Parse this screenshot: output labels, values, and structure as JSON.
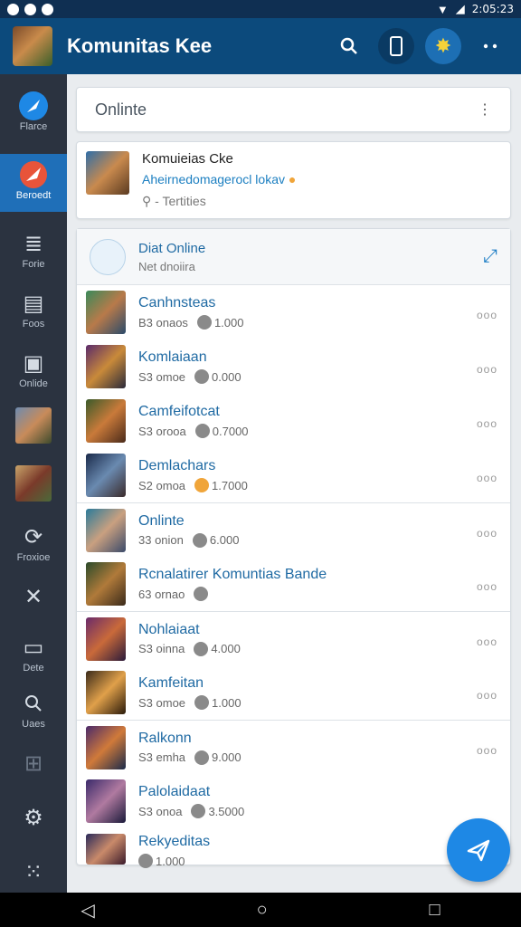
{
  "status": {
    "time": "2:05:23"
  },
  "appbar": {
    "title": "Komunitas Kee"
  },
  "sidebar": [
    {
      "label": "Flarce",
      "icon": "feather-icon",
      "active": false
    },
    {
      "label": "Beroedt",
      "icon": "game-controller-icon",
      "active": true
    },
    {
      "label": "Forie",
      "icon": "layers-icon",
      "active": false
    },
    {
      "label": "Foos",
      "icon": "book-icon",
      "active": false
    },
    {
      "label": "Onlide",
      "icon": "folder-icon",
      "active": false
    },
    {
      "label": "",
      "icon": "game-thumbnail",
      "active": false
    },
    {
      "label": "",
      "icon": "game-thumbnail",
      "active": false
    },
    {
      "label": "Froxioe",
      "icon": "refresh-icon",
      "active": false
    },
    {
      "label": "",
      "icon": "tools-icon",
      "active": false
    },
    {
      "label": "Dete",
      "icon": "chat-icon",
      "active": false
    },
    {
      "label": "Uaes",
      "icon": "search-icon",
      "active": false
    },
    {
      "label": "",
      "icon": "split-icon",
      "active": false
    },
    {
      "label": "",
      "icon": "gear-icon",
      "active": false
    },
    {
      "label": "",
      "icon": "apps-grid-icon",
      "active": false
    }
  ],
  "search": {
    "placeholder": "Onlinte"
  },
  "feature": {
    "title": "Komuieias Cke",
    "subtitle": "Aheirnedomagerocl lokav",
    "search_hint": "- Tertities"
  },
  "list": {
    "header_title": "Diat Online",
    "header_sub": "Net dnoiira",
    "rows": [
      {
        "name": "Canhnsteas",
        "meta": "B3 onaos",
        "value": "1.000",
        "coin": "gray"
      },
      {
        "name": "Komlaiaan",
        "meta": "S3 omoe",
        "value": "0.000",
        "coin": "gray"
      },
      {
        "name": "Camfeifotcat",
        "meta": "S3 orooa",
        "value": "0.7000",
        "coin": "gray"
      },
      {
        "name": "Demlachars",
        "meta": "S2 omoa",
        "value": "1.7000",
        "coin": "gold"
      },
      {
        "name": "Onlinte",
        "meta": "33 onion",
        "value": "6.000",
        "coin": "gray"
      },
      {
        "name": "Rcnalatirer Komuntias Bande",
        "meta": "63 ornao",
        "value": "",
        "coin": "gray"
      },
      {
        "name": "Nohlaiaat",
        "meta": "S3 oinna",
        "value": "4.000",
        "coin": "gray"
      },
      {
        "name": "Kamfeitan",
        "meta": "S3 omoe",
        "value": "1.000",
        "coin": "gray"
      },
      {
        "name": "Ralkonn",
        "meta": "S3 emha",
        "value": "9.000",
        "coin": "gray"
      },
      {
        "name": "Palolaidaat",
        "meta": "S3 onoa",
        "value": "3.5000",
        "coin": "gray"
      },
      {
        "name": "Rekyeditas",
        "meta": "",
        "value": "1.000",
        "coin": "gray"
      }
    ]
  }
}
